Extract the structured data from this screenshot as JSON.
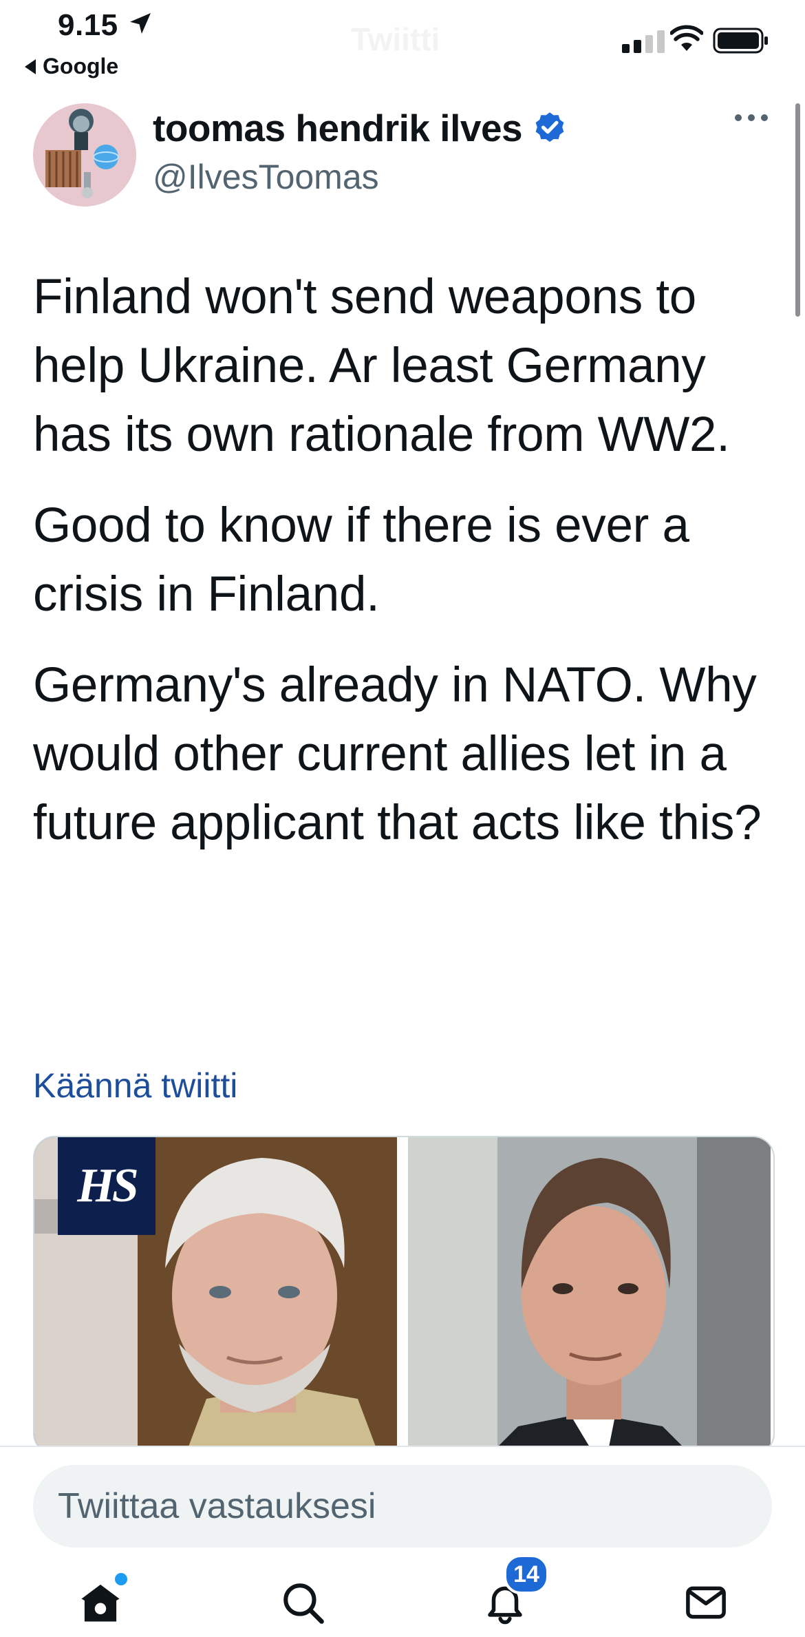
{
  "status_bar": {
    "time": "9.15",
    "back_app": "Google",
    "ghost_title": "Twiitti"
  },
  "tweet": {
    "author_name": "toomas hendrik ilves",
    "author_handle": "@IlvesToomas",
    "verified": true,
    "paragraphs": [
      "Finland won't send weapons to help Ukraine. Ar least Germany has its own rationale from WW2.",
      "Good to know if there is ever a crisis in Finland.",
      "Germany's already in NATO. Why would other current allies let in a future applicant that acts like this?"
    ],
    "translate_label": "Käännä twiitti",
    "media_logo": "HS"
  },
  "reply": {
    "placeholder": "Twiittaa vastauksesi"
  },
  "tabbar": {
    "notifications_count": "14"
  },
  "colors": {
    "link": "#1d4e9b",
    "verified": "#1d6ad6",
    "badge": "#1d6ad6",
    "hs_logo_bg": "#0c1f4d"
  },
  "icons": [
    "location-arrow-icon",
    "signal-icon",
    "wifi-icon",
    "battery-icon",
    "more-icon",
    "verified-icon",
    "home-icon",
    "search-icon",
    "notifications-icon",
    "messages-icon"
  ]
}
